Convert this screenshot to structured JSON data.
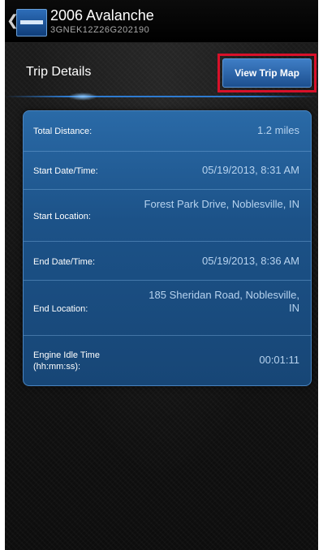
{
  "header": {
    "back_icon": "chevron-left-icon",
    "logo_icon": "vehicle-logo-icon",
    "vehicle_name": "2006 Avalanche",
    "vin": "3GNEK12Z26G202190"
  },
  "section": {
    "title": "Trip Details",
    "map_button_label": "View Trip Map"
  },
  "details": [
    {
      "label": "Total Distance:",
      "value": "1.2 miles"
    },
    {
      "label": "Start Date/Time:",
      "value": "05/19/2013, 8:31 AM"
    },
    {
      "label": "Start Location:",
      "value": "Forest Park Drive, Noblesville, IN"
    },
    {
      "label": "End Date/Time:",
      "value": "05/19/2013, 8:36 AM"
    },
    {
      "label": "End Location:",
      "value": "185 Sheridan Road, Noblesville, IN"
    },
    {
      "label": "Engine Idle Time (hh:mm:ss):",
      "value": "00:01:11"
    }
  ],
  "colors": {
    "accent": "#2e7bd0",
    "highlight_outline": "#d8112a",
    "card": "#1c5288"
  }
}
